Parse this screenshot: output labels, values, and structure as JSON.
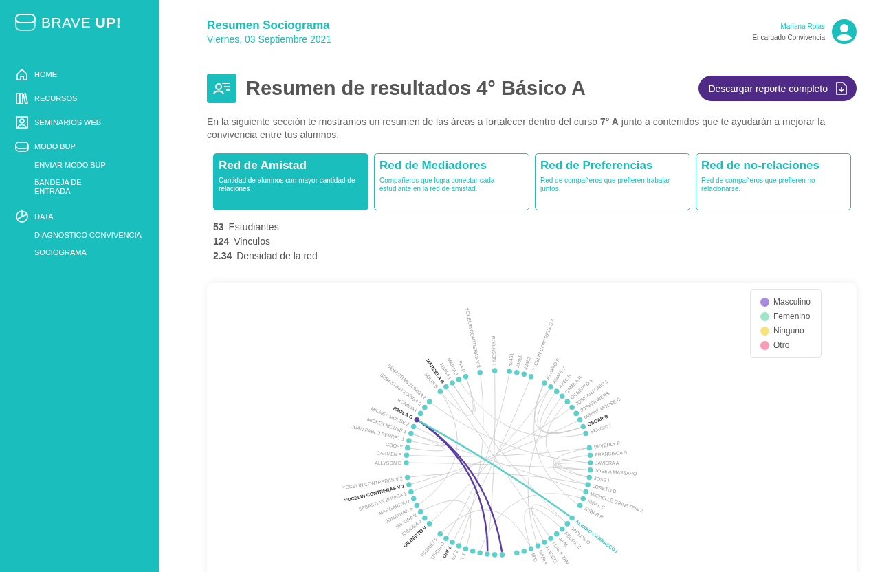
{
  "brand": {
    "name": "BRAVE",
    "accent": "UP!"
  },
  "sidebar": {
    "items": [
      {
        "label": "HOME"
      },
      {
        "label": "RECURSOS"
      },
      {
        "label": "SEMINARIOS WEB"
      },
      {
        "label": "MODO BUP",
        "children": [
          {
            "label": "ENVIAR MODO BUP"
          },
          {
            "label": "BANDEJA DE ENTRADA"
          }
        ]
      },
      {
        "label": "DATA",
        "children": [
          {
            "label": "DIAGNOSTICO CONVIVENCIA"
          },
          {
            "label": "SOCIOGRAMA"
          }
        ]
      }
    ]
  },
  "header": {
    "title": "Resumen Sociograma",
    "date": "Viernes, 03 Septiembre 2021",
    "user_name": "Mariana Rojas",
    "user_role": "Encargado Convivencia"
  },
  "page_title": "Resumen de resultados 4° Básico A",
  "download_button": "Descargar reporte completo",
  "description": "En la siguiente sección te mostramos un resumen de las áreas a fortalecer dentro del curso **7° A** junto a contenidos que te ayudarán a mejorar la convivencia entre tus alumnos.",
  "tabs": [
    {
      "title": "Red de Amistad",
      "subtitle": "Cantidad de alumnos con mayor cantidad de relaciones",
      "selected": true
    },
    {
      "title": "Red de Mediadores",
      "subtitle": "Compañeros que logra conectar cada estudiante en la red de amistad.",
      "selected": false
    },
    {
      "title": "Red de Preferencias",
      "subtitle": "Red de compañeros que prefieren trabajar juntos.",
      "selected": false
    },
    {
      "title": "Red de no-relaciones",
      "subtitle": "Red de compañeros que prefieren no relacionarse.",
      "selected": false
    }
  ],
  "stats": [
    "**53** Estudiantes",
    "**124** Vinculos",
    "**2.34** Densidad de la red"
  ],
  "legend": [
    {
      "label": "Masculino",
      "color": "#a98bdc"
    },
    {
      "label": "Femenino",
      "color": "#9ee6c6"
    },
    {
      "label": "Ninguno",
      "color": "#f7e37b"
    },
    {
      "label": "Otro",
      "color": "#f69cb6"
    }
  ],
  "network": {
    "groups": [
      {
        "nodes": [
          {
            "label": "ALLYSON D",
            "color": "#5ecfc9",
            "kind": "plain"
          },
          {
            "label": "CARMEN B",
            "color": "#5ecfc9",
            "kind": "plain"
          },
          {
            "label": "GOOFY",
            "color": "#5ecfc9",
            "kind": "plain"
          },
          {
            "label": "JUAN PABLO PERRET 1",
            "color": "#5ecfc9",
            "kind": "plain"
          },
          {
            "label": "MICKEY MOUSE 1",
            "color": "#5ecfc9",
            "kind": "plain"
          },
          {
            "label": "MICKEY MOUSE 2",
            "color": "#5ecfc9",
            "kind": "plain"
          },
          {
            "label": "PAOLA G",
            "color": "#5b3fa0",
            "kind": "bold"
          },
          {
            "label": "ROMINA I",
            "color": "#5ecfc9",
            "kind": "plain"
          },
          {
            "label": "SEBASTIAN ZUÑIGA 3",
            "color": "#5ecfc9",
            "kind": "plain"
          },
          {
            "label": "SEBASTIAN ZUÑIGA 2",
            "color": "#5ecfc9",
            "kind": "plain"
          }
        ]
      },
      {
        "nodes": [
          {
            "label": "SOLIS B",
            "color": "#5ecfc9",
            "kind": "plain"
          },
          {
            "label": "MARCELA B",
            "color": "#5ecfc9",
            "kind": "bold"
          },
          {
            "label": "MARIA I",
            "color": "#5ecfc9",
            "kind": "plain"
          },
          {
            "label": "MARIA J",
            "color": "#5ecfc9",
            "kind": "plain"
          },
          {
            "label": "PIA P",
            "color": "#5ecfc9",
            "kind": "plain"
          }
        ]
      },
      {
        "nodes": [
          {
            "label": "YOCELIN CONTRERAS V 3",
            "color": "#5ecfc9",
            "kind": "plain"
          }
        ]
      },
      {
        "nodes": [
          {
            "label": "ROBINSON T",
            "color": "#5ecfc9",
            "kind": "plain"
          }
        ]
      },
      {
        "nodes": [
          {
            "label": "43461",
            "color": "#5ecfc9",
            "kind": "plain"
          },
          {
            "label": "43488",
            "color": "#5ecfc9",
            "kind": "plain"
          },
          {
            "label": "43483",
            "color": "#5ecfc9",
            "kind": "plain"
          },
          {
            "label": "YOCELIN CONTRERAS 4",
            "color": "#5ecfc9",
            "kind": "plain"
          }
        ]
      },
      {
        "nodes": [
          {
            "label": "ALVARO F",
            "color": "#5ecfc9",
            "kind": "plain"
          },
          {
            "label": "ANAHI V",
            "color": "#5ecfc9",
            "kind": "plain"
          },
          {
            "label": "AXEL B",
            "color": "#5ecfc9",
            "kind": "plain"
          },
          {
            "label": "CAMILA R",
            "color": "#5ecfc9",
            "kind": "plain"
          },
          {
            "label": "GILBERTO Y",
            "color": "#5ecfc9",
            "kind": "plain"
          },
          {
            "label": "JOSE ANTONIO 1",
            "color": "#5ecfc9",
            "kind": "plain"
          },
          {
            "label": "JOSEFA WERS",
            "color": "#5ecfc9",
            "kind": "plain"
          },
          {
            "label": "MINNIE MOUSE C",
            "color": "#5ecfc9",
            "kind": "plain"
          },
          {
            "label": "OSCAR B",
            "color": "#5ecfc9",
            "kind": "bold"
          },
          {
            "label": "SERGIO I",
            "color": "#5ecfc9",
            "kind": "plain"
          }
        ]
      },
      {
        "nodes": [
          {
            "label": "BEVERLY P",
            "color": "#5ecfc9",
            "kind": "plain"
          },
          {
            "label": "FRANCISCA S",
            "color": "#5ecfc9",
            "kind": "plain"
          },
          {
            "label": "JAVIERA A",
            "color": "#5ecfc9",
            "kind": "plain"
          },
          {
            "label": "JOSE A MASSARO",
            "color": "#5ecfc9",
            "kind": "plain"
          },
          {
            "label": "JOSE I",
            "color": "#5ecfc9",
            "kind": "plain"
          },
          {
            "label": "LORETO D",
            "color": "#5ecfc9",
            "kind": "plain"
          },
          {
            "label": "MICHELLE GRINSTEIN 2",
            "color": "#5ecfc9",
            "kind": "plain"
          },
          {
            "label": "SIGAL C",
            "color": "#5ecfc9",
            "kind": "plain"
          },
          {
            "label": "TOBAR R",
            "color": "#5ecfc9",
            "kind": "plain"
          }
        ]
      },
      {
        "nodes": [
          {
            "label": "ALVARO CARRASCO I",
            "color": "#5ecfc9",
            "kind": "accent"
          },
          {
            "label": "CARLOS O",
            "color": "#5ecfc9",
            "kind": "plain"
          },
          {
            "label": "FELIPE Z",
            "color": "#5ecfc9",
            "kind": "plain"
          },
          {
            "label": "JA M",
            "color": "#5ecfc9",
            "kind": "plain"
          },
          {
            "label": "LUIS F ZAN",
            "color": "#5ecfc9",
            "kind": "plain"
          },
          {
            "label": "MARCEL",
            "color": "#5ecfc9",
            "kind": "plain"
          },
          {
            "label": "MARIA",
            "color": "#5ecfc9",
            "kind": "plain"
          },
          {
            "label": "MIC",
            "color": "#5ecfc9",
            "kind": "plain"
          },
          {
            "color": "#5ecfc9"
          },
          {
            "color": "#5ecfc9"
          }
        ]
      },
      {
        "nodes": [
          {
            "color": "#5ecfc9"
          },
          {
            "color": "#5ecfc9"
          },
          {
            "color": "#5ecfc9"
          },
          {
            "color": "#5ecfc9"
          },
          {
            "color": "#5ecfc9"
          },
          {
            "label": "T 1",
            "color": "#5ecfc9",
            "kind": "plain"
          },
          {
            "label": "EZ 2",
            "color": "#5ecfc9",
            "kind": "plain"
          },
          {
            "label": "ONI 2",
            "color": "#5ecfc9",
            "kind": "bold"
          },
          {
            "label": "TRICIA O",
            "color": "#5ecfc9",
            "kind": "plain"
          },
          {
            "label": "PERRET P",
            "color": "#5ecfc9",
            "kind": "plain"
          }
        ]
      },
      {
        "nodes": [
          {
            "label": "GILBERTO V",
            "color": "#5ecfc9",
            "kind": "bold"
          },
          {
            "label": "ISIDORA J",
            "color": "#5ecfc9",
            "kind": "plain"
          },
          {
            "label": "ISIDORA V",
            "color": "#5ecfc9",
            "kind": "plain"
          },
          {
            "label": "JONATHAN S",
            "color": "#5ecfc9",
            "kind": "plain"
          },
          {
            "label": "MARGARITA D",
            "color": "#5ecfc9",
            "kind": "plain"
          },
          {
            "label": "SEBASTIAN ZUNIGA 1",
            "color": "#5ecfc9",
            "kind": "plain"
          },
          {
            "label": "YOCELIN CONTRERAS V 1",
            "color": "#5ecfc9",
            "kind": "bold"
          },
          {
            "label": "YOCELIN CONTRERAS V 2",
            "color": "#5ecfc9",
            "kind": "plain"
          }
        ]
      }
    ]
  }
}
